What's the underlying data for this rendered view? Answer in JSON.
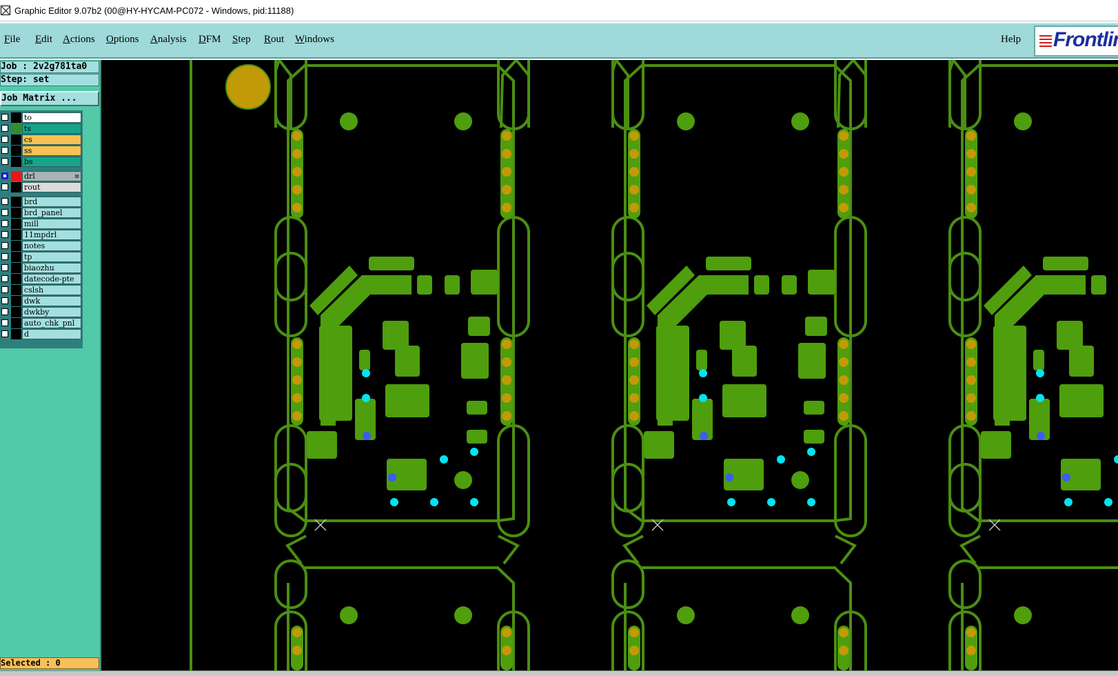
{
  "titlebar": {
    "title": "Graphic Editor 9.07b2 (00@HY-HYCAM-PC072 - Windows, pid:11188)"
  },
  "menu": {
    "items": [
      {
        "mn": "F",
        "rest": "ile"
      },
      {
        "mn": "E",
        "rest": "dit"
      },
      {
        "mn": "A",
        "rest": "ctions"
      },
      {
        "mn": "O",
        "rest": "ptions"
      },
      {
        "mn": "A",
        "rest": "nalysis"
      },
      {
        "mn": "D",
        "rest": "FM"
      },
      {
        "mn": "S",
        "rest": "tep"
      },
      {
        "mn": "R",
        "rest": "out"
      },
      {
        "mn": "W",
        "rest": "indows"
      }
    ],
    "help": "Help",
    "logo": "Frontline"
  },
  "panel": {
    "job": "Job : 2v2g781ta0",
    "step": "Step: set",
    "job_matrix": "Job Matrix ...",
    "selected": "Selected : 0"
  },
  "layers": [
    {
      "name": "to",
      "bg": "#ffffff",
      "swatch": "#000000"
    },
    {
      "name": "ts",
      "bg": "#17a58a",
      "swatch": "#2f8e2f"
    },
    {
      "name": "cs",
      "bg": "#f8c153",
      "swatch": "#000000"
    },
    {
      "name": "ss",
      "bg": "#f8c153",
      "swatch": "#000000"
    },
    {
      "name": "bs",
      "bg": "#17a58a",
      "swatch": "#000000"
    },
    {
      "name": "drl",
      "bg": "#a8b4b4",
      "swatch": "#e81818",
      "active": true,
      "mark": "⊠"
    },
    {
      "name": "rout",
      "bg": "#dcdcdc",
      "swatch": "#000000"
    },
    {
      "name": "brd",
      "bg": "#a4dfdf",
      "swatch": "#000000"
    },
    {
      "name": "brd_panel",
      "bg": "#a4dfdf",
      "swatch": "#000000"
    },
    {
      "name": "mill",
      "bg": "#a4dfdf",
      "swatch": "#000000"
    },
    {
      "name": "11mpdrl",
      "bg": "#a4dfdf",
      "swatch": "#000000"
    },
    {
      "name": "notes",
      "bg": "#a4dfdf",
      "swatch": "#000000"
    },
    {
      "name": "tp",
      "bg": "#a4dfdf",
      "swatch": "#000000"
    },
    {
      "name": "biaozhu",
      "bg": "#a4dfdf",
      "swatch": "#000000"
    },
    {
      "name": "datecode-pte",
      "bg": "#a4dfdf",
      "swatch": "#000000"
    },
    {
      "name": "cslsh",
      "bg": "#a4dfdf",
      "swatch": "#000000"
    },
    {
      "name": "dwk",
      "bg": "#a4dfdf",
      "swatch": "#000000"
    },
    {
      "name": "dwkby",
      "bg": "#a4dfdf",
      "swatch": "#000000"
    },
    {
      "name": "auto_chk_pnl",
      "bg": "#a4dfdf",
      "swatch": "#000000"
    },
    {
      "name": "d",
      "bg": "#a4dfdf",
      "swatch": "#000000"
    }
  ],
  "colors": {
    "canvas_bg": "#000000",
    "board_green": "#4f9e0d",
    "outline_green": "#4a8f12",
    "pad_gold": "#c29a07",
    "via_cyan": "#00e5f0",
    "via_blue": "#3a5cf0"
  }
}
